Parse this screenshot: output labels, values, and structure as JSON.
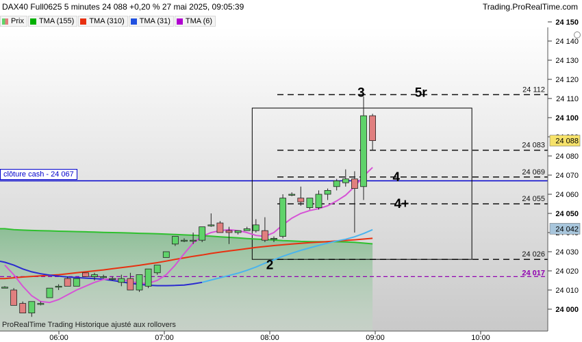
{
  "header": {
    "instrument_info": "DAX40 Full0625 5 minutes 24 088 +0,20 % 27 mai 2025, 09:05:39",
    "brand": "Trading.ProRealTime.com"
  },
  "legend": [
    {
      "label": "Prix",
      "color": "#d9534f",
      "icon": "candle-icon"
    },
    {
      "label": "TMA (155)",
      "color": "#00b000"
    },
    {
      "label": "TMA (310)",
      "color": "#e83010"
    },
    {
      "label": "TMA (31)",
      "color": "#2050e0"
    },
    {
      "label": "TMA (6)",
      "color": "#b000d0"
    }
  ],
  "cash_close_label": "clôture cash -  24 067",
  "footer_text": "ProRealTime Trading  Historique ajusté aux rollovers",
  "colors": {
    "up": "#5fd36a",
    "down": "#e07f7f",
    "tma155": "#2ec02e",
    "tma310": "#e83010",
    "tma31_a": "#2a2ad0",
    "tma31_b": "#4ab4ee",
    "tma6": "#d653d6",
    "cash_line": "#0000cc",
    "level_24017": "#9000b0"
  },
  "chart_data": {
    "type": "candlestick",
    "x_ticks": [
      "06:00",
      "07:00",
      "08:00",
      "09:00",
      "10:00"
    ],
    "y_ticks": [
      24000,
      24010,
      24020,
      24030,
      24040,
      24050,
      24060,
      24070,
      24080,
      24090,
      24100,
      24110,
      24120,
      24130,
      24140,
      24150
    ],
    "ylim": [
      23996,
      24156
    ],
    "candles": [
      {
        "o": 24011.5,
        "h": 24012,
        "l": 24011,
        "c": 24011.5
      },
      {
        "o": 24010,
        "h": 24011,
        "l": 24002,
        "c": 24002
      },
      {
        "o": 24003,
        "h": 24004,
        "l": 23998,
        "c": 23998
      },
      {
        "o": 23998,
        "h": 24004,
        "l": 23996,
        "c": 24004
      },
      {
        "o": 24003,
        "h": 24004,
        "l": 24002,
        "c": 24003
      },
      {
        "o": 24006,
        "h": 24011,
        "l": 24006,
        "c": 24011
      },
      {
        "o": 24012,
        "h": 24013,
        "l": 24010,
        "c": 24012
      },
      {
        "o": 24016,
        "h": 24017,
        "l": 24012,
        "c": 24012
      },
      {
        "o": 24012,
        "h": 24016,
        "l": 24012,
        "c": 24016
      },
      {
        "o": 24019,
        "h": 24019,
        "l": 24017,
        "c": 24017
      },
      {
        "o": 24017,
        "h": 24019,
        "l": 24015,
        "c": 24018
      },
      {
        "o": 24017,
        "h": 24018,
        "l": 24016,
        "c": 24017
      },
      {
        "o": 24016,
        "h": 24017,
        "l": 24015,
        "c": 24016
      },
      {
        "o": 24014,
        "h": 24018,
        "l": 24012,
        "c": 24016
      },
      {
        "o": 24016,
        "h": 24019,
        "l": 24010,
        "c": 24010
      },
      {
        "o": 24010,
        "h": 24018,
        "l": 24009,
        "c": 24018
      },
      {
        "o": 24012,
        "h": 24021,
        "l": 24011,
        "c": 24021
      },
      {
        "o": 24019,
        "h": 24023,
        "l": 24018,
        "c": 24023
      },
      {
        "o": 24027,
        "h": 24030,
        "l": 24027,
        "c": 24030
      },
      {
        "o": 24034,
        "h": 24038,
        "l": 24033,
        "c": 24038
      },
      {
        "o": 24036,
        "h": 24037,
        "l": 24035,
        "c": 24036
      },
      {
        "o": 24036,
        "h": 24040,
        "l": 24034,
        "c": 24036
      },
      {
        "o": 24036,
        "h": 24043,
        "l": 24035,
        "c": 24043
      },
      {
        "o": 24044,
        "h": 24050,
        "l": 24043,
        "c": 24044
      },
      {
        "o": 24045,
        "h": 24046,
        "l": 24040,
        "c": 24040
      },
      {
        "o": 24041,
        "h": 24043,
        "l": 24034,
        "c": 24040
      },
      {
        "o": 24040,
        "h": 24041,
        "l": 24039,
        "c": 24041
      },
      {
        "o": 24041,
        "h": 24043,
        "l": 24041,
        "c": 24042
      },
      {
        "o": 24041,
        "h": 24047,
        "l": 24040,
        "c": 24044
      },
      {
        "o": 24041,
        "h": 24048,
        "l": 24035,
        "c": 24036
      },
      {
        "o": 24037,
        "h": 24038,
        "l": 24035,
        "c": 24037
      },
      {
        "o": 24038,
        "h": 24060,
        "l": 24037,
        "c": 24058
      },
      {
        "o": 24060,
        "h": 24061,
        "l": 24059,
        "c": 24060
      },
      {
        "o": 24058,
        "h": 24064,
        "l": 24054,
        "c": 24056
      },
      {
        "o": 24053,
        "h": 24058,
        "l": 24052,
        "c": 24058
      },
      {
        "o": 24053,
        "h": 24062,
        "l": 24052,
        "c": 24060
      },
      {
        "o": 24060,
        "h": 24063,
        "l": 24057,
        "c": 24062
      },
      {
        "o": 24064,
        "h": 24068,
        "l": 24062,
        "c": 24067
      },
      {
        "o": 24066,
        "h": 24073,
        "l": 24064,
        "c": 24068
      },
      {
        "o": 24068,
        "h": 24072,
        "l": 24040,
        "c": 24063
      },
      {
        "o": 24064,
        "h": 24111,
        "l": 24057,
        "c": 24101
      },
      {
        "o": 24101,
        "h": 24102,
        "l": 24083,
        "c": 24088
      }
    ],
    "tma_155": [
      [
        0,
        24042
      ],
      [
        1,
        24041.5
      ],
      [
        2,
        24041.3
      ],
      [
        3,
        24041.1
      ],
      [
        4,
        24041
      ],
      [
        5,
        24040.9
      ],
      [
        6,
        24040.7
      ],
      [
        7,
        24040.6
      ],
      [
        8,
        24040.5
      ],
      [
        9,
        24040.4
      ],
      [
        10,
        24040.3
      ],
      [
        11,
        24040.1
      ],
      [
        12,
        24040
      ],
      [
        13,
        24039.9
      ],
      [
        14,
        24039.8
      ],
      [
        15,
        24039.6
      ],
      [
        16,
        24039.5
      ],
      [
        17,
        24039.4
      ],
      [
        18,
        24039.2
      ],
      [
        19,
        24039
      ],
      [
        20,
        24038.8
      ],
      [
        21,
        24038.6
      ],
      [
        22,
        24038.4
      ],
      [
        23,
        24038.1
      ],
      [
        24,
        24037.8
      ],
      [
        25,
        24037.5
      ],
      [
        26,
        24037.2
      ],
      [
        27,
        24036.9
      ],
      [
        28,
        24036.6
      ],
      [
        29,
        24036.4
      ],
      [
        30,
        24036.1
      ],
      [
        31,
        24035.8
      ],
      [
        32,
        24035.6
      ],
      [
        33,
        24035.4
      ],
      [
        34,
        24035.3
      ],
      [
        35,
        24035.2
      ],
      [
        36,
        24035.2
      ],
      [
        37,
        24035.2
      ],
      [
        38,
        24035.1
      ],
      [
        39,
        24034.9
      ],
      [
        40,
        24034.5
      ],
      [
        41,
        24034.1
      ]
    ],
    "tma_310": [
      [
        0,
        24016
      ],
      [
        1,
        24016.4
      ],
      [
        2,
        24016.8
      ],
      [
        3,
        24017.1
      ],
      [
        4,
        24017.4
      ],
      [
        5,
        24017.7
      ],
      [
        6,
        24018
      ],
      [
        7,
        24018.5
      ],
      [
        8,
        24019
      ],
      [
        9,
        24019.5
      ],
      [
        10,
        24020
      ],
      [
        11,
        24020.5
      ],
      [
        12,
        24021.1
      ],
      [
        13,
        24021.7
      ],
      [
        14,
        24022.3
      ],
      [
        15,
        24022.9
      ],
      [
        16,
        24023.6
      ],
      [
        17,
        24024.3
      ],
      [
        18,
        24025.1
      ],
      [
        19,
        24026
      ],
      [
        20,
        24026.8
      ],
      [
        21,
        24027.6
      ],
      [
        22,
        24028.3
      ],
      [
        23,
        24029.1
      ],
      [
        24,
        24029.8
      ],
      [
        25,
        24030.4
      ],
      [
        26,
        24031
      ],
      [
        27,
        24031.6
      ],
      [
        28,
        24032.2
      ],
      [
        29,
        24032.7
      ],
      [
        30,
        24033.2
      ],
      [
        31,
        24033.6
      ],
      [
        32,
        24034
      ],
      [
        33,
        24034.4
      ],
      [
        34,
        24034.7
      ],
      [
        35,
        24035
      ],
      [
        36,
        24035.3
      ],
      [
        37,
        24035.6
      ],
      [
        38,
        24035.9
      ],
      [
        39,
        24036.2
      ],
      [
        40,
        24036.6
      ],
      [
        41,
        24037
      ]
    ],
    "tma_31": [
      [
        0,
        24024.5
      ],
      [
        1,
        24023
      ],
      [
        2,
        24021
      ],
      [
        3,
        24019.5
      ],
      [
        4,
        24018.5
      ],
      [
        5,
        24017.8
      ],
      [
        6,
        24017.3
      ],
      [
        7,
        24016.8
      ],
      [
        8,
        24016.5
      ],
      [
        9,
        24016.2
      ],
      [
        10,
        24016
      ],
      [
        11,
        24015.6
      ],
      [
        12,
        24015
      ],
      [
        13,
        24014.3
      ],
      [
        14,
        24013.5
      ],
      [
        15,
        24013
      ],
      [
        16,
        24012.5
      ],
      [
        17,
        24012.3
      ],
      [
        18,
        24012.3
      ],
      [
        19,
        24012.4
      ],
      [
        20,
        24012.6
      ],
      [
        21,
        24013.2
      ],
      [
        22,
        24014
      ],
      [
        23,
        24015.2
      ],
      [
        24,
        24016.4
      ],
      [
        25,
        24017.6
      ],
      [
        26,
        24018.8
      ],
      [
        27,
        24020.3
      ],
      [
        28,
        24022
      ],
      [
        29,
        24024
      ],
      [
        30,
        24025.8
      ],
      [
        31,
        24027.6
      ],
      [
        32,
        24029.2
      ],
      [
        33,
        24030.7
      ],
      [
        34,
        24032
      ],
      [
        35,
        24033.3
      ],
      [
        36,
        24034.5
      ],
      [
        37,
        24035.6
      ],
      [
        38,
        24036.5
      ],
      [
        39,
        24037.8
      ],
      [
        40,
        24039.5
      ],
      [
        41,
        24041.5
      ]
    ],
    "tma_6": [
      [
        0,
        24023
      ],
      [
        1,
        24018
      ],
      [
        2,
        24012
      ],
      [
        3,
        24007
      ],
      [
        4,
        24004
      ],
      [
        5,
        24003.5
      ],
      [
        6,
        24005
      ],
      [
        7,
        24007.5
      ],
      [
        8,
        24010
      ],
      [
        9,
        24012
      ],
      [
        10,
        24014
      ],
      [
        11,
        24015.5
      ],
      [
        12,
        24016
      ],
      [
        13,
        24015.5
      ],
      [
        14,
        24014.5
      ],
      [
        15,
        24013.5
      ],
      [
        16,
        24013.5
      ],
      [
        17,
        24015
      ],
      [
        18,
        24018
      ],
      [
        19,
        24023
      ],
      [
        20,
        24029
      ],
      [
        21,
        24034.5
      ],
      [
        22,
        24038
      ],
      [
        23,
        24040
      ],
      [
        24,
        24041
      ],
      [
        25,
        24041.5
      ],
      [
        26,
        24041
      ],
      [
        27,
        24040
      ],
      [
        28,
        24038.5
      ],
      [
        29,
        24038
      ],
      [
        30,
        24040
      ],
      [
        31,
        24044
      ],
      [
        32,
        24047.5
      ],
      [
        33,
        24050
      ],
      [
        34,
        24051.5
      ],
      [
        35,
        24052.5
      ],
      [
        36,
        24054
      ],
      [
        37,
        24056.5
      ],
      [
        38,
        24059.5
      ],
      [
        39,
        24064
      ],
      [
        40,
        24069.5
      ],
      [
        41,
        24074
      ]
    ],
    "horizontal_levels": [
      {
        "value": 24112,
        "label": "24 112",
        "style": "dashed"
      },
      {
        "value": 24083,
        "label": "24 083",
        "style": "dashed"
      },
      {
        "value": 24069,
        "label": "24 069",
        "style": "dashed"
      },
      {
        "value": 24055,
        "label": "24 055",
        "style": "dashed"
      },
      {
        "value": 24026,
        "label": "24 026",
        "style": "dashed"
      },
      {
        "value": 24017,
        "label": "24 017",
        "style": "dashed-purple"
      },
      {
        "value": 24067,
        "label": "clôture cash -  24 067",
        "style": "solid-blue"
      }
    ],
    "box": {
      "from": "07:50",
      "to": "09:55",
      "low": 24026,
      "high": 24105
    },
    "annotations": [
      {
        "text": "3",
        "time": "08:52",
        "value": 24113
      },
      {
        "text": "5r",
        "time": "09:26",
        "value": 24113
      },
      {
        "text": "4",
        "time": "09:12",
        "value": 24069
      },
      {
        "text": "4+",
        "time": "09:15",
        "value": 24055
      },
      {
        "text": "2",
        "time": "08:00",
        "value": 24023
      }
    ],
    "price_markers": [
      {
        "value": 24088,
        "label": "24 088",
        "style": "current"
      },
      {
        "value": 24042,
        "label": "24 042",
        "style": "tma"
      }
    ]
  }
}
